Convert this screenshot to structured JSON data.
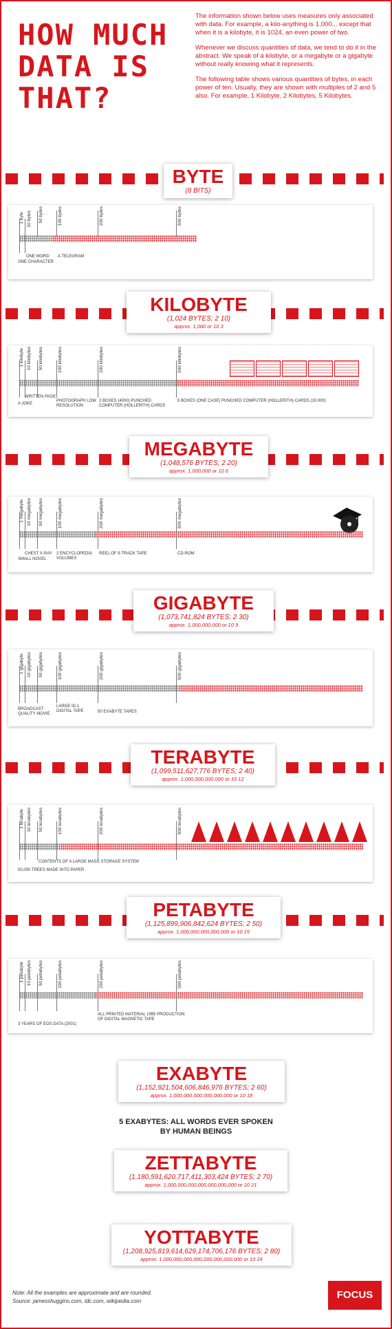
{
  "title": "How much data is that?",
  "intro": [
    "The information shown below uses measures only associated with data. For example, a kilo-anything is 1,000... except that when it is a kilobyte, it is 1024, an even power of two.",
    "Whenever we discuss quantities of data, we tend to do it in the abstract. We speak of a kilobyte, or a megabyte or a gigabyte without really knowing what it represents.",
    "The following table shows various quantities of bytes, in each power of ten. Usually, they are shown with multiples of 2 and 5 also. For example, 1 Kilobyte, 2 Kilobytes, 5 Kilobytes."
  ],
  "sections": {
    "byte": {
      "name": "BYTE",
      "sub": "(8 BITS)",
      "ticks": [
        "1 byte",
        "10 bytes",
        "50 bytes",
        "100 bytes",
        "200 bytes",
        "500 bytes"
      ],
      "notes": {
        "a": "ONE WORD",
        "b": "ONE CHARACTER",
        "c": "A TELEGRAM"
      }
    },
    "kilobyte": {
      "name": "KILOBYTE",
      "sub": "(1,024 BYTES; 2 10)",
      "approx": "approx. 1,000 or 10 3",
      "ticks": [
        "1 kilobyte",
        "10 kilobytes",
        "50 kilobytes",
        "100 kilobytes",
        "200 kilobytes",
        "500 kilobytes"
      ],
      "notes": {
        "a": "A JOKE",
        "b": "WRITTEN PAGE",
        "c": "PHOTOGRAPH LOW RESOLUTION",
        "d": "2 BOXES (4000) PUNCHED COMPUTER (HOLLERITH) CARDS",
        "e": "5 BOXES (ONE CASE) PUNCHED COMPUTER (HOLLERITH) CARDS (10,000)"
      }
    },
    "megabyte": {
      "name": "MEGABYTE",
      "sub": "(1,048,576 BYTES; 2 20)",
      "approx": "approx. 1,000,000 or 10 6",
      "ticks": [
        "1 megabyte",
        "10 megabytes",
        "50 megabytes",
        "100 megabytes",
        "200 megabytes",
        "500 megabytes"
      ],
      "notes": {
        "a": "CHEST X-RAY",
        "b": "SMALL NOVEL",
        "c": "2 ENCYCLOPEDIA VOLUMES",
        "d": "REEL OF 9-TRACK TAPE",
        "e": "CD-ROM"
      }
    },
    "gigabyte": {
      "name": "GIGABYTE",
      "sub": "(1,073,741,824 BYTES; 2 30)",
      "approx": "approx. 1,000,000,000 or 10 9",
      "ticks": [
        "1 gigabyte",
        "10 gigabytes",
        "50 gigabytes",
        "100 gigabytes",
        "200 gigabytes",
        "500 gigabytes"
      ],
      "notes": {
        "a": "BROADCAST QUALITY MOVIE",
        "b": "LARGE ID-1 DIGITAL TAPE",
        "c": "50 EXABYTE TAPES"
      }
    },
    "terabyte": {
      "name": "TERABYTE",
      "sub": "(1,099,511,627,776 BYTES; 2 40)",
      "approx": "approx. 1,000,000,000,000 or 10 12",
      "ticks": [
        "1 terabyte",
        "10 terabytes",
        "50 terabytes",
        "100 terabytes",
        "200 terabytes",
        "500 terabytes"
      ],
      "notes": {
        "a": "CONTENTS OF A LARGE MASS STORAGE SYSTEM",
        "b": "50,000 TREES MADE INTO PAPER"
      }
    },
    "petabyte": {
      "name": "PETABYTE",
      "sub": "(1,125,899,906,842,624 BYTES; 2 50)",
      "approx": "approx. 1,000,000,000,000,000 or 10 15",
      "ticks": [
        "1 petabyte",
        "10 petabytes",
        "50 petabytes",
        "100 petabytes",
        "200 petabytes",
        "500 petabytes"
      ],
      "notes": {
        "a": "3 YEARS OF EOS DATA (2001)",
        "b": "ALL PRINTED MATERIAL 1995 PRODUCTION OF DIGITAL MAGNETIC TAPE"
      }
    },
    "exabyte": {
      "name": "EXABYTE",
      "sub": "(1,152,921,504,606,846,976 BYTES; 2 60)",
      "approx": "approx. 1,000,000,000,000,000,000 or 10 18",
      "note": "5 EXABYTES: ALL WORDS EVER SPOKEN BY HUMAN BEINGS"
    },
    "zettabyte": {
      "name": "ZETTABYTE",
      "sub": "(1,180,591,620,717,411,303,424 BYTES; 2 70)",
      "approx": "approx. 1,000,000,000,000,000,000,000 or 10 21"
    },
    "yottabyte": {
      "name": "YOTTABYTE",
      "sub": "(1,208,925,819,614,629,174,706,176 BYTES; 2 80)",
      "approx": "approx. 1,000,000,000,000,000,000,000,000 or 10 24"
    }
  },
  "footer": {
    "note": "Note: All the examples are approximate and are rounded.",
    "source": "Source: jamesshuggins.com, idc.com, wikipedia.com",
    "logo": "FOCUS"
  },
  "colors": {
    "accent": "#d6161c"
  }
}
